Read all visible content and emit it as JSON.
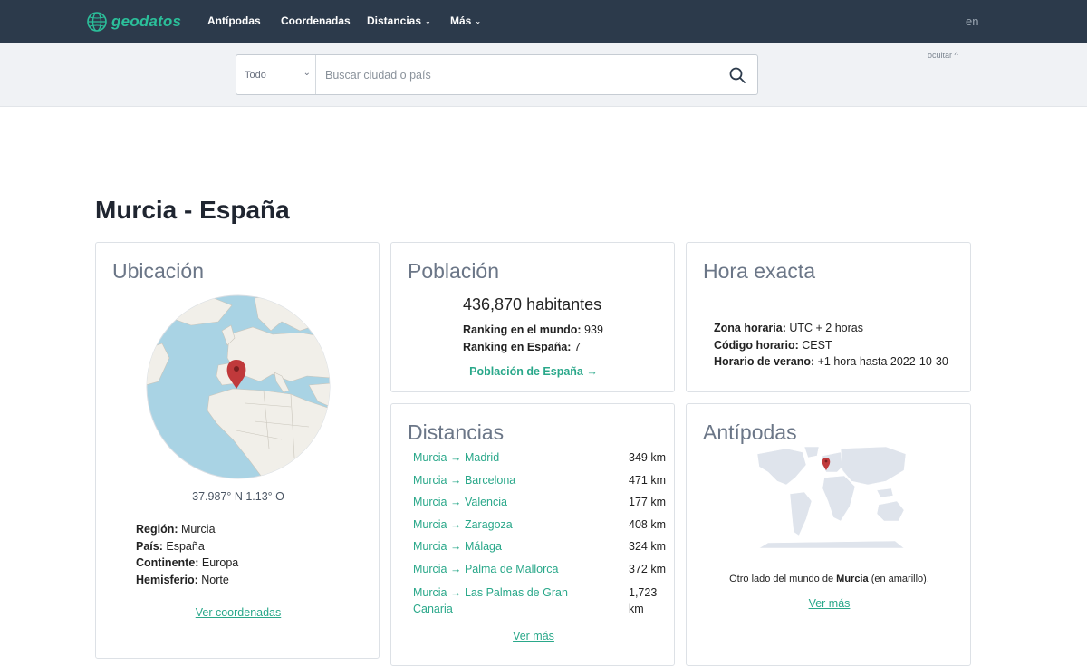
{
  "nav": {
    "logo_text": "geodatos",
    "items": [
      {
        "label": "Antípodas",
        "dropdown": false
      },
      {
        "label": "Coordenadas",
        "dropdown": false
      },
      {
        "label": "Distancias",
        "dropdown": true
      },
      {
        "label": "Más",
        "dropdown": true
      }
    ],
    "language": "en"
  },
  "search": {
    "scope_selected": "Todo",
    "placeholder": "Buscar ciudad o país",
    "hide_label": "ocultar ^"
  },
  "page": {
    "title": "Murcia - España"
  },
  "location_card": {
    "title": "Ubicación",
    "coordinates": "37.987° N 1.13° O",
    "fields": [
      {
        "label": "Región:",
        "value": "Murcia"
      },
      {
        "label": "País:",
        "value": "España"
      },
      {
        "label": "Continente:",
        "value": "Europa"
      },
      {
        "label": "Hemisferio:",
        "value": "Norte"
      }
    ],
    "link": "Ver coordenadas"
  },
  "population_card": {
    "title": "Población",
    "population": "436,870 habitantes",
    "world_rank_label": "Ranking en el mundo:",
    "world_rank_value": "939",
    "country_rank_label": "Ranking en España:",
    "country_rank_value": "7",
    "link": "Población de España →"
  },
  "time_card": {
    "title": "Hora exacta",
    "fields": [
      {
        "label": "Zona horaria:",
        "value": "UTC + 2 horas"
      },
      {
        "label": "Código horario:",
        "value": "CEST"
      },
      {
        "label": "Horario de verano:",
        "value": "+1 hora hasta 2022-10-30"
      }
    ]
  },
  "distances_card": {
    "title": "Distancias",
    "rows": [
      {
        "route": "Murcia → Madrid",
        "km": "349 km"
      },
      {
        "route": "Murcia → Barcelona",
        "km": "471 km"
      },
      {
        "route": "Murcia → Valencia",
        "km": "177 km"
      },
      {
        "route": "Murcia → Zaragoza",
        "km": "408 km"
      },
      {
        "route": "Murcia → Málaga",
        "km": "324 km"
      },
      {
        "route": "Murcia → Palma de Mallorca",
        "km": "372 km"
      },
      {
        "route_line1": "Murcia → Las Palmas de Gran",
        "route_line2": "Canaria",
        "km_line1": "1,723",
        "km_line2": "km"
      }
    ],
    "link": "Ver más"
  },
  "antipodes_card": {
    "title": "Antípodas",
    "caption_prefix": "Otro lado del mundo de",
    "caption_city": "Murcia",
    "caption_suffix": "(en amarillo).",
    "link": "Ver más"
  },
  "colors": {
    "nav_bg": "#2c3a4b",
    "accent": "#2aa88a",
    "marker_red": "#c0393b",
    "marker_yellow": "#f4b400",
    "ocean": "#a9d3e4",
    "land": "#f1efe9"
  },
  "icons": [
    "globe-logo-icon",
    "chevron-down-icon",
    "search-icon",
    "map-pin-icon"
  ]
}
